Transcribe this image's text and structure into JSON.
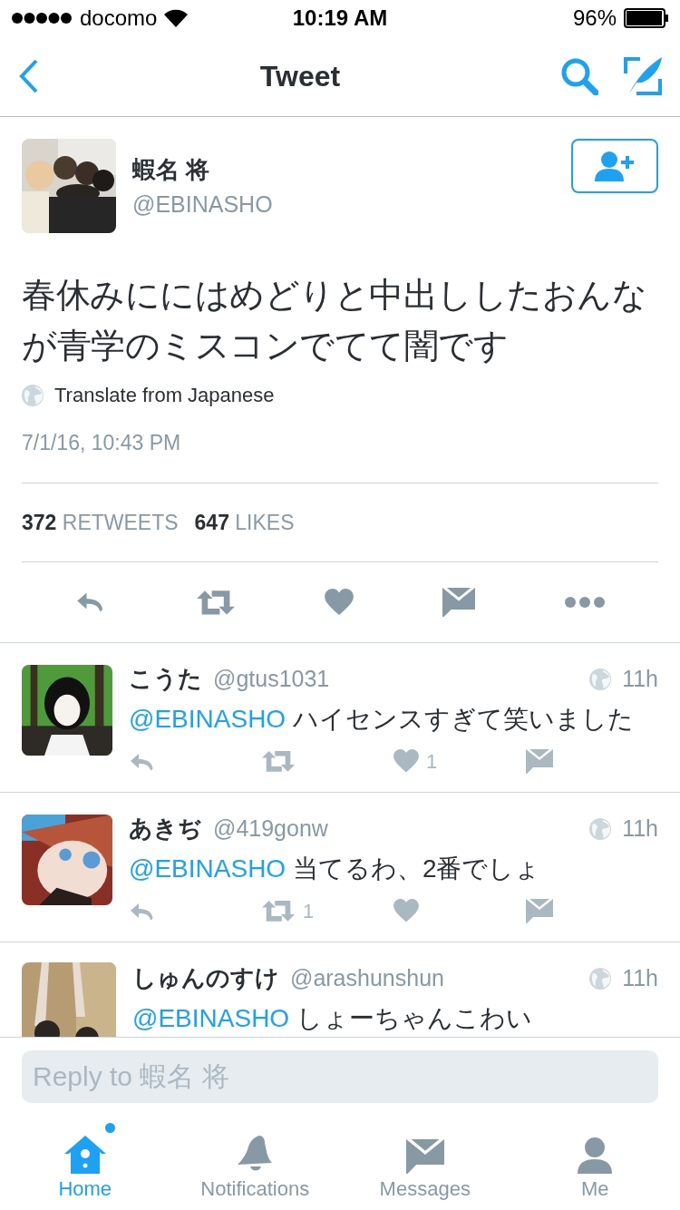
{
  "status_bar": {
    "carrier": "docomo",
    "time": "10:19 AM",
    "battery": "96%"
  },
  "nav": {
    "title": "Tweet"
  },
  "tweet": {
    "name": "蝦名 将",
    "handle": "@EBINASHO",
    "text": "春休みににはめどりと中出ししたおんなが青学のミスコンでてて闇です",
    "translate": "Translate from Japanese",
    "date": "7/1/16, 10:43 PM",
    "stats": [
      {
        "count": "372",
        "label": "RETWEETS"
      },
      {
        "count": "647",
        "label": "LIKES"
      }
    ]
  },
  "replies": [
    {
      "name": "こうた",
      "handle": "@gtus1031",
      "time": "11h",
      "mention": "@EBINASHO",
      "text": "ハイセンスすぎて笑いました",
      "likes": "1"
    },
    {
      "name": "あきぢ",
      "handle": "@419gonw",
      "time": "11h",
      "mention": "@EBINASHO",
      "text": "当てるわ、2番でしょ",
      "retweets": "1"
    },
    {
      "name": "しゅんのすけ",
      "handle": "@arashunshun",
      "time": "11h",
      "mention": "@EBINASHO",
      "text": "しょーちゃんこわい"
    }
  ],
  "reply_field": {
    "placeholder": "Reply to 蝦名 将"
  },
  "tabs": [
    {
      "label": "Home",
      "kind": "home",
      "selected": true,
      "dot": true
    },
    {
      "label": "Notifications",
      "kind": "bell",
      "selected": false,
      "dot": false
    },
    {
      "label": "Messages",
      "kind": "mail",
      "selected": false,
      "dot": false
    },
    {
      "label": "Me",
      "kind": "person",
      "selected": false,
      "dot": false
    }
  ]
}
